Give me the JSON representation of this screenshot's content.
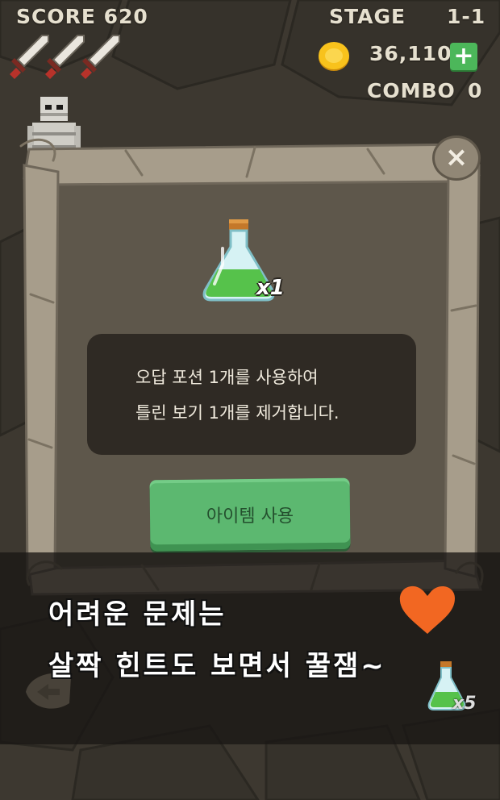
{
  "hud": {
    "score": "SCORE 620",
    "stage_label": "STAGE",
    "stage_value": "1-1",
    "coins": "36,110",
    "combo_label": "COMBO",
    "combo_value": "0",
    "plus_label": "+",
    "lives_shown": 3
  },
  "dialog": {
    "close_label": "×",
    "item_count": "x1",
    "message_line1": "오답 포션 1개를 사용하여",
    "message_line2": "틀린 보기 1개를 제거합니다.",
    "use_button": "아이템 사용"
  },
  "promo": {
    "caption_line1": "어려운 문제는",
    "caption_line2": "살짝 힌트도 보면서 꿀잼~"
  },
  "inventory": {
    "potion_count": "x5"
  },
  "colors": {
    "background": "#3d3830",
    "button_green": "#5cb870",
    "potion_green": "#56c24b",
    "heart": "#f26722"
  }
}
